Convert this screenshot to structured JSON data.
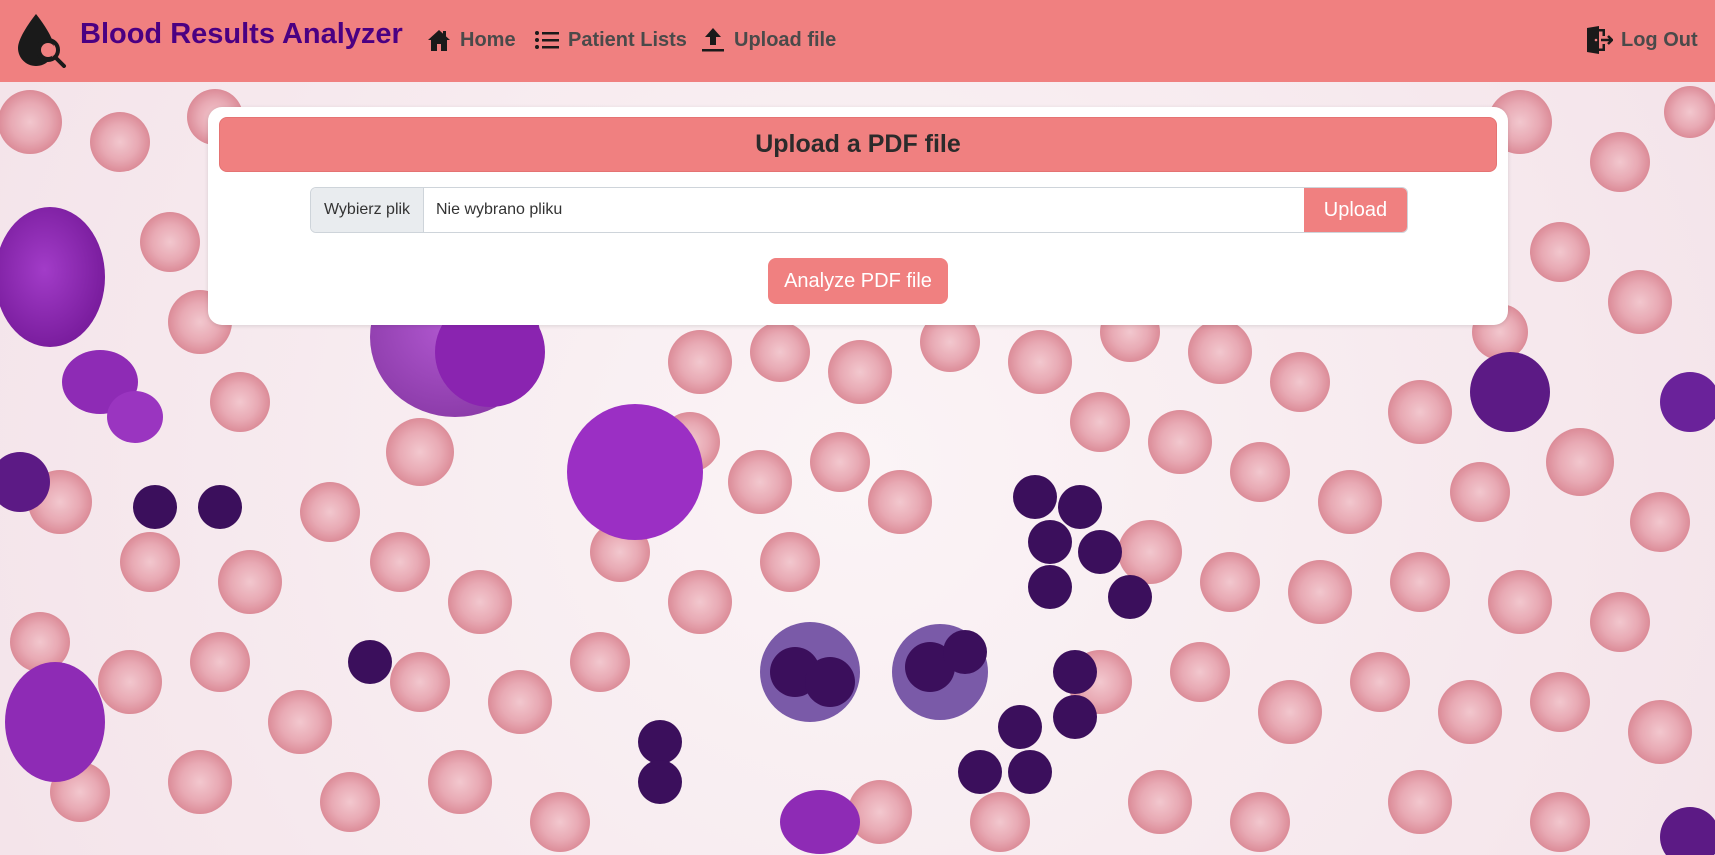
{
  "app": {
    "title": "Blood Results Analyzer",
    "logo_icon": "blood-drop-magnifier-icon"
  },
  "nav": {
    "items": [
      {
        "label": "Home",
        "icon": "home-icon"
      },
      {
        "label": "Patient Lists",
        "icon": "list-icon"
      },
      {
        "label": "Upload file",
        "icon": "upload-icon"
      }
    ],
    "logout": {
      "label": "Log Out",
      "icon": "logout-icon"
    }
  },
  "upload_card": {
    "title": "Upload a PDF file",
    "file_input": {
      "choose_label": "Wybierz plik",
      "status": "Nie wybrano pliku"
    },
    "upload_button": "Upload",
    "analyze_button": "Analyze PDF file"
  },
  "colors": {
    "navbar": "#f08080",
    "brand": "#4b0082",
    "button": "#f08080",
    "background_cells": [
      "#e79aa6",
      "#8e2bb5",
      "#3b0f5c"
    ]
  }
}
